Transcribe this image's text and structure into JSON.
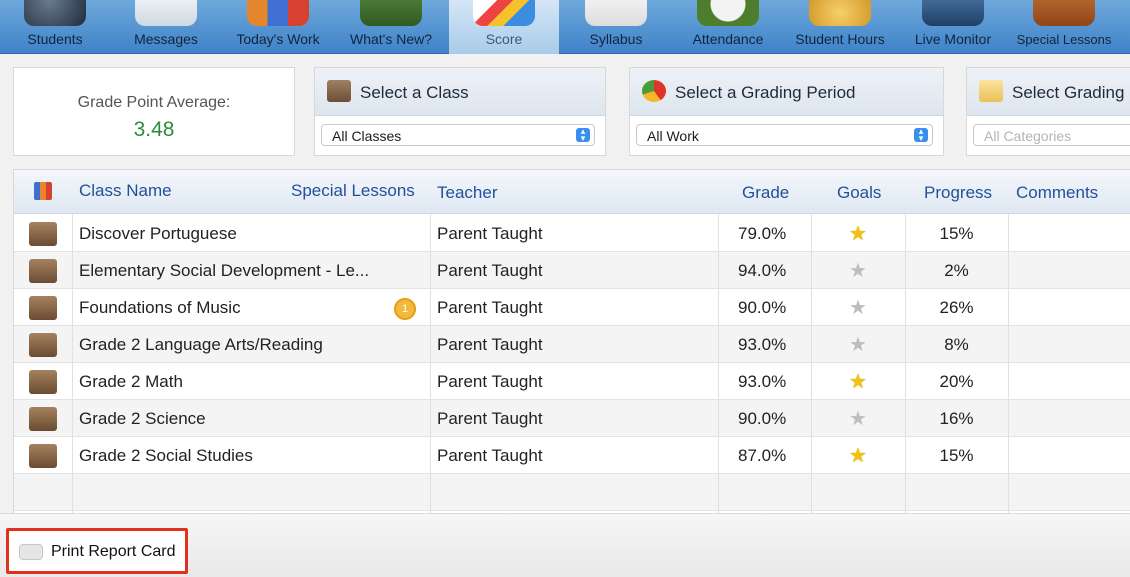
{
  "nav": {
    "items": [
      {
        "label": "Students",
        "color": "#2f3e52"
      },
      {
        "label": "Messages",
        "color": "#e9eef3"
      },
      {
        "label": "Today's Work",
        "color": "#e4872c"
      },
      {
        "label": "What's New?",
        "color": "#3d6b2d"
      },
      {
        "label": "Score",
        "color": "#f2f2f2"
      },
      {
        "label": "Syllabus",
        "color": "#f7f7f7"
      },
      {
        "label": "Attendance",
        "color": "#4f7d2e"
      },
      {
        "label": "Student Hours",
        "color": "#e8b23a"
      },
      {
        "label": "Live Monitor",
        "color": "#2a4f7a"
      },
      {
        "label": "Special Lessons",
        "color": "#b3642a"
      }
    ],
    "active_label": "Score"
  },
  "gpa": {
    "label": "Grade Point Average:",
    "value": "3.48"
  },
  "filters": {
    "class": {
      "title": "Select a Class",
      "value": "All Classes"
    },
    "period": {
      "title": "Select a Grading Period",
      "value": "All Work"
    },
    "category": {
      "title": "Select Grading C",
      "value": "All Categories"
    }
  },
  "table": {
    "headers": {
      "class_name": "Class Name",
      "special_lessons": "Special Lessons",
      "teacher": "Teacher",
      "grade": "Grade",
      "goals": "Goals",
      "progress": "Progress",
      "comments": "Comments"
    },
    "rows": [
      {
        "class_name": "Discover Portuguese",
        "teacher": "Parent Taught",
        "grade": "79.0%",
        "goal_star": "gold",
        "progress": "15%"
      },
      {
        "class_name": "Elementary Social Development - Le...",
        "teacher": "Parent Taught",
        "grade": "94.0%",
        "goal_star": "gray",
        "progress": "2%"
      },
      {
        "class_name": "Foundations of Music",
        "teacher": "Parent Taught",
        "grade": "90.0%",
        "goal_star": "gray",
        "progress": "26%",
        "badge": "1"
      },
      {
        "class_name": "Grade 2 Language Arts/Reading",
        "teacher": "Parent Taught",
        "grade": "93.0%",
        "goal_star": "gray",
        "progress": "8%"
      },
      {
        "class_name": "Grade 2 Math",
        "teacher": "Parent Taught",
        "grade": "93.0%",
        "goal_star": "gold",
        "progress": "20%"
      },
      {
        "class_name": "Grade 2 Science",
        "teacher": "Parent Taught",
        "grade": "90.0%",
        "goal_star": "gray",
        "progress": "16%"
      },
      {
        "class_name": "Grade 2 Social Studies",
        "teacher": "Parent Taught",
        "grade": "87.0%",
        "goal_star": "gold",
        "progress": "15%"
      }
    ]
  },
  "footer": {
    "print_label": "Print Report Card"
  }
}
